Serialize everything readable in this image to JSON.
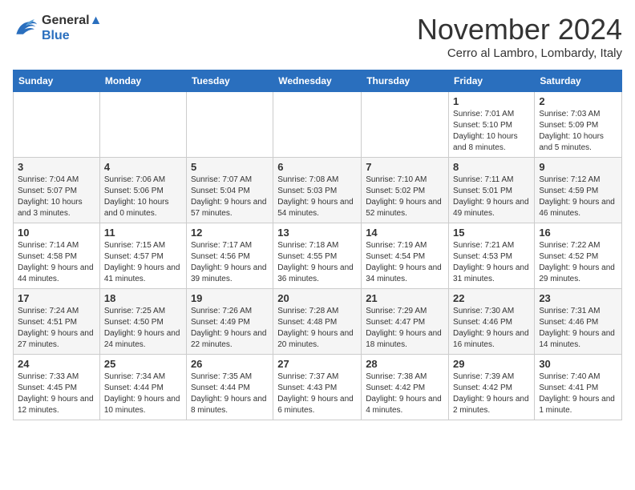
{
  "header": {
    "logo_line1": "General",
    "logo_line2": "Blue",
    "title": "November 2024",
    "subtitle": "Cerro al Lambro, Lombardy, Italy"
  },
  "weekdays": [
    "Sunday",
    "Monday",
    "Tuesday",
    "Wednesday",
    "Thursday",
    "Friday",
    "Saturday"
  ],
  "weeks": [
    [
      {
        "day": "",
        "info": ""
      },
      {
        "day": "",
        "info": ""
      },
      {
        "day": "",
        "info": ""
      },
      {
        "day": "",
        "info": ""
      },
      {
        "day": "",
        "info": ""
      },
      {
        "day": "1",
        "info": "Sunrise: 7:01 AM\nSunset: 5:10 PM\nDaylight: 10 hours and 8 minutes."
      },
      {
        "day": "2",
        "info": "Sunrise: 7:03 AM\nSunset: 5:09 PM\nDaylight: 10 hours and 5 minutes."
      }
    ],
    [
      {
        "day": "3",
        "info": "Sunrise: 7:04 AM\nSunset: 5:07 PM\nDaylight: 10 hours and 3 minutes."
      },
      {
        "day": "4",
        "info": "Sunrise: 7:06 AM\nSunset: 5:06 PM\nDaylight: 10 hours and 0 minutes."
      },
      {
        "day": "5",
        "info": "Sunrise: 7:07 AM\nSunset: 5:04 PM\nDaylight: 9 hours and 57 minutes."
      },
      {
        "day": "6",
        "info": "Sunrise: 7:08 AM\nSunset: 5:03 PM\nDaylight: 9 hours and 54 minutes."
      },
      {
        "day": "7",
        "info": "Sunrise: 7:10 AM\nSunset: 5:02 PM\nDaylight: 9 hours and 52 minutes."
      },
      {
        "day": "8",
        "info": "Sunrise: 7:11 AM\nSunset: 5:01 PM\nDaylight: 9 hours and 49 minutes."
      },
      {
        "day": "9",
        "info": "Sunrise: 7:12 AM\nSunset: 4:59 PM\nDaylight: 9 hours and 46 minutes."
      }
    ],
    [
      {
        "day": "10",
        "info": "Sunrise: 7:14 AM\nSunset: 4:58 PM\nDaylight: 9 hours and 44 minutes."
      },
      {
        "day": "11",
        "info": "Sunrise: 7:15 AM\nSunset: 4:57 PM\nDaylight: 9 hours and 41 minutes."
      },
      {
        "day": "12",
        "info": "Sunrise: 7:17 AM\nSunset: 4:56 PM\nDaylight: 9 hours and 39 minutes."
      },
      {
        "day": "13",
        "info": "Sunrise: 7:18 AM\nSunset: 4:55 PM\nDaylight: 9 hours and 36 minutes."
      },
      {
        "day": "14",
        "info": "Sunrise: 7:19 AM\nSunset: 4:54 PM\nDaylight: 9 hours and 34 minutes."
      },
      {
        "day": "15",
        "info": "Sunrise: 7:21 AM\nSunset: 4:53 PM\nDaylight: 9 hours and 31 minutes."
      },
      {
        "day": "16",
        "info": "Sunrise: 7:22 AM\nSunset: 4:52 PM\nDaylight: 9 hours and 29 minutes."
      }
    ],
    [
      {
        "day": "17",
        "info": "Sunrise: 7:24 AM\nSunset: 4:51 PM\nDaylight: 9 hours and 27 minutes."
      },
      {
        "day": "18",
        "info": "Sunrise: 7:25 AM\nSunset: 4:50 PM\nDaylight: 9 hours and 24 minutes."
      },
      {
        "day": "19",
        "info": "Sunrise: 7:26 AM\nSunset: 4:49 PM\nDaylight: 9 hours and 22 minutes."
      },
      {
        "day": "20",
        "info": "Sunrise: 7:28 AM\nSunset: 4:48 PM\nDaylight: 9 hours and 20 minutes."
      },
      {
        "day": "21",
        "info": "Sunrise: 7:29 AM\nSunset: 4:47 PM\nDaylight: 9 hours and 18 minutes."
      },
      {
        "day": "22",
        "info": "Sunrise: 7:30 AM\nSunset: 4:46 PM\nDaylight: 9 hours and 16 minutes."
      },
      {
        "day": "23",
        "info": "Sunrise: 7:31 AM\nSunset: 4:46 PM\nDaylight: 9 hours and 14 minutes."
      }
    ],
    [
      {
        "day": "24",
        "info": "Sunrise: 7:33 AM\nSunset: 4:45 PM\nDaylight: 9 hours and 12 minutes."
      },
      {
        "day": "25",
        "info": "Sunrise: 7:34 AM\nSunset: 4:44 PM\nDaylight: 9 hours and 10 minutes."
      },
      {
        "day": "26",
        "info": "Sunrise: 7:35 AM\nSunset: 4:44 PM\nDaylight: 9 hours and 8 minutes."
      },
      {
        "day": "27",
        "info": "Sunrise: 7:37 AM\nSunset: 4:43 PM\nDaylight: 9 hours and 6 minutes."
      },
      {
        "day": "28",
        "info": "Sunrise: 7:38 AM\nSunset: 4:42 PM\nDaylight: 9 hours and 4 minutes."
      },
      {
        "day": "29",
        "info": "Sunrise: 7:39 AM\nSunset: 4:42 PM\nDaylight: 9 hours and 2 minutes."
      },
      {
        "day": "30",
        "info": "Sunrise: 7:40 AM\nSunset: 4:41 PM\nDaylight: 9 hours and 1 minute."
      }
    ]
  ]
}
